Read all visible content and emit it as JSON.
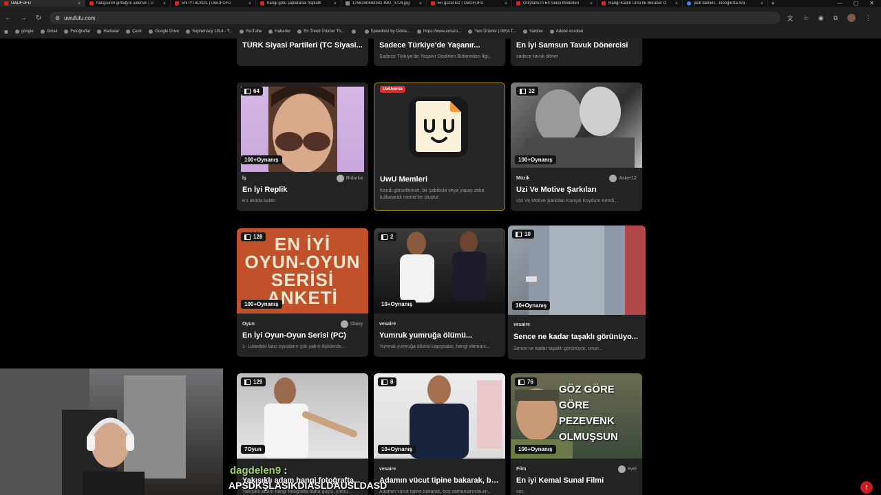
{
  "browser": {
    "tabs": [
      {
        "label": "UwUFUFU",
        "active": true
      },
      {
        "label": "hangisinin girtlağını sikersin | U"
      },
      {
        "label": "EN İYİ ALKOL | UwUFUFU"
      },
      {
        "label": "hangi götü şaplatarak hoplattı"
      },
      {
        "label": "1756240693342-IMG_0724.jpg"
      },
      {
        "label": "En güzel kız | UwUFUFU"
      },
      {
        "label": "Onlyfans'ın En Seksi Modelleri"
      },
      {
        "label": "Hangi Kadın Ünlü İle Beraber O"
      },
      {
        "label": "jack daniels - Google'da Ara"
      }
    ],
    "url": "uwufufu.com",
    "bookmarks": [
      "google",
      "Gmail",
      "Fotoğraflar",
      "Haritalar",
      "Çevir",
      "Google Drive",
      "Supremacy 1914 - T...",
      "YouTube",
      "Haberler",
      "En Trend Ürünler Tü...",
      "",
      "Speedtest by Ookla...",
      "https://www.amazo...",
      "Yeni Ürünler | IKEA T...",
      "Yandex",
      "Adobe Acrobat"
    ]
  },
  "top_row": [
    {
      "title": "TÜRK Siyasi Partileri (TC Siyasi...",
      "desc": ""
    },
    {
      "title": "Sadece Türkiye'de Yaşanır...",
      "desc": "Sadece Türkiye'de Yaşanır Dedirten Birbirinden İlgi..."
    },
    {
      "title": "En İyi Samsun Tavuk Dönercisi",
      "desc": "sadece tavuk döner"
    }
  ],
  "cards": [
    {
      "count": "64",
      "plays": "100+Oynanış",
      "category": "İş",
      "author": "Ridarka",
      "title": "En İyi Replik",
      "desc": "En akılda kalan"
    },
    {
      "badge": "UwUverse",
      "title": "UwU Memleri",
      "desc": "Kendi görsellerinle, bir şablonla veya yapay zeka kullanarak meme'ler oluştur."
    },
    {
      "count": "32",
      "plays": "100+Oynanış",
      "category": "Müzik",
      "author": "Asker12",
      "title": "Uzi Ve Motive Şarkıları",
      "desc": "Uzi Ve Motive Şarkıları Karışık Koydum Kendi..."
    },
    {
      "count": "128",
      "plays": "100+Oynanış",
      "category": "Oyun",
      "author": "Glaxy",
      "title": "En İyi Oyun-Oyun Serisi (PC)",
      "desc": "1- Listedeki bazı oyunların çok yakın ilişkilerde...",
      "thumb_text": [
        "EN İYİ",
        "OYUN-OYUN",
        "SERİSİ",
        "ANKETİ"
      ]
    },
    {
      "count": "2",
      "plays": "10+Oynanış",
      "category": "vesaire",
      "title": "Yumruk yumruğa ölümü...",
      "desc": "Yumruk yumruğa ölümü kapışsalar, hangi elemanı..."
    },
    {
      "count": "10",
      "plays": "10+Oynanış",
      "category": "vesaire",
      "title": "Sence ne kadar taşaklı görünüyo...",
      "desc": "Sence ne kadar taşaklı görünüyor, onun..."
    },
    {
      "count": "129",
      "plays": "7Oyun",
      "category": "",
      "title": "Yakışıklı adam hangi fotoğrafta...",
      "desc": "Yakışıklı adam hangi fotoğrafta daha güçlü, yırtıcı..."
    },
    {
      "count": "8",
      "plays": "10+Oynanış",
      "category": "vesaire",
      "title": "Adamın vücut tipine bakarak, bo...",
      "desc": "Adamın vücut tipine bakarak, boş zamanlarında en..."
    },
    {
      "count": "76",
      "plays": "100+Oynanış",
      "category": "Film",
      "author": "evet",
      "title": "En iyi Kemal Sunal Filmi",
      "desc": "sec",
      "thumb_text": [
        "GÖZ GÖRE GÖRE",
        "PEZEVENK",
        "OLMUŞSUN"
      ]
    }
  ],
  "overlay": {
    "chat_user": "dagdelen9",
    "chat_colon": ":",
    "chat_message": "APSDKŞLASIKDIASLDAUSLDASD"
  },
  "colors": {
    "accent": "#d42f2f",
    "highlight_border": "#a58a1b"
  }
}
